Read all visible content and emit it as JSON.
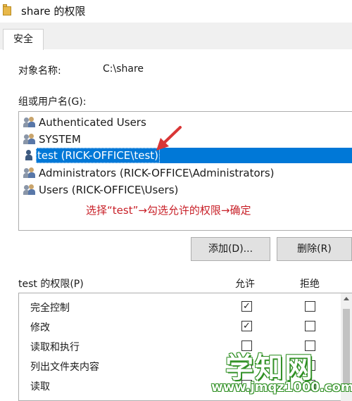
{
  "window": {
    "title": "share 的权限"
  },
  "tabs": [
    {
      "label": "安全"
    }
  ],
  "object": {
    "label": "对象名称:",
    "value": "C:\\share"
  },
  "groups": {
    "label": "组或用户名(G):",
    "items": [
      {
        "name": "Authenticated Users",
        "icon": "users-group-icon"
      },
      {
        "name": "SYSTEM",
        "icon": "users-group-icon"
      },
      {
        "name": "test (RICK-OFFICE\\test)",
        "icon": "user-icon",
        "selected": true
      },
      {
        "name": "Administrators (RICK-OFFICE\\Administrators)",
        "icon": "users-group-icon"
      },
      {
        "name": "Users (RICK-OFFICE\\Users)",
        "icon": "users-group-icon"
      }
    ]
  },
  "annotation": {
    "text": "选择“test”→勾选允许的权限→确定",
    "color": "#c81f27"
  },
  "buttons": {
    "add": "添加(D)...",
    "remove": "删除(R)"
  },
  "permissions": {
    "label": "test 的权限(P)",
    "allow_header": "允许",
    "deny_header": "拒绝",
    "rows": [
      {
        "name": "完全控制",
        "allow": true,
        "deny": false
      },
      {
        "name": "修改",
        "allow": true,
        "deny": false
      },
      {
        "name": "读取和执行",
        "allow": false,
        "deny": false
      },
      {
        "name": "列出文件夹内容",
        "allow": false,
        "deny": false
      },
      {
        "name": "读取",
        "allow": false,
        "deny": false
      }
    ],
    "check_glyph": "✓"
  },
  "watermark": {
    "main": "学知网",
    "sub": "www.jmqz1000.com",
    "color": "#2f8f23"
  },
  "colors": {
    "selection": "#0078d7",
    "arrow": "#d93636"
  }
}
